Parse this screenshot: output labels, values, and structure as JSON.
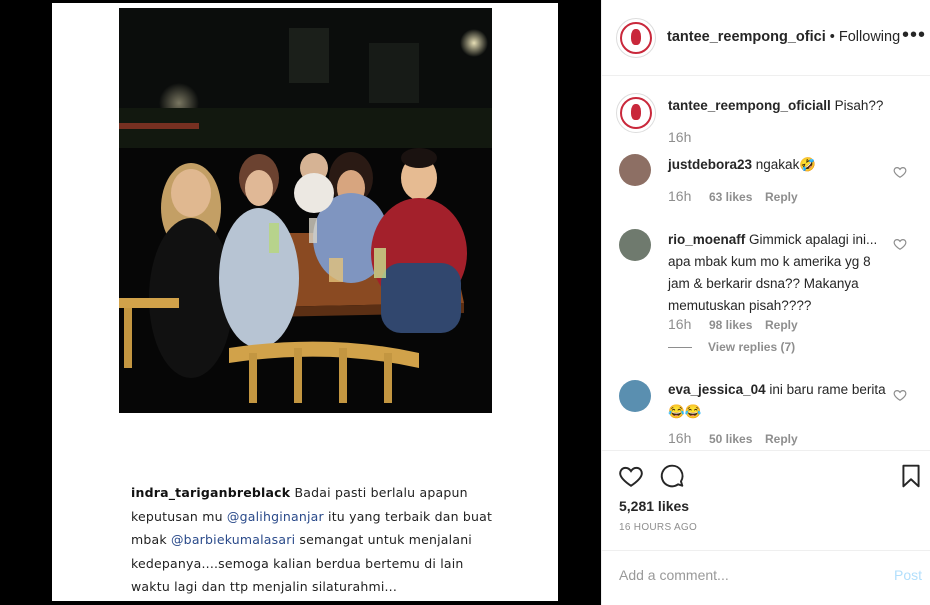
{
  "post": {
    "caption_user": "indra_tariganbreblack",
    "caption_lines": [
      " Badai pasti berlalu apapun",
      "keputusan mu ",
      " itu yang terbaik dan buat",
      "mbak ",
      " semangat untuk menjalani",
      "kedepanya....semoga kalian berdua bertemu di lain",
      "waktu lagi dan ttp menjalin silaturahmi..."
    ],
    "mention_1": "@galihginanjar",
    "mention_2": "@barbiekumalasari"
  },
  "header": {
    "username": "tantee_reempong_ofici",
    "separator": " • ",
    "follow_status": "Following",
    "more": "•••"
  },
  "comments": [
    {
      "user": "tantee_reempong_oficiall",
      "text": " Pisah??",
      "time": "16h",
      "likes": "",
      "reply": ""
    },
    {
      "user": "justdebora23",
      "text": " ngakak🤣",
      "time": "16h",
      "likes": "63 likes",
      "reply": "Reply"
    },
    {
      "user": "rio_moenaff",
      "text": " Gimmick apalagi ini... apa mbak kum mo k amerika yg 8 jam & berkarir dsna?? Makanya memutuskan pisah????",
      "time": "16h",
      "likes": "98 likes",
      "reply": "Reply",
      "view_replies": "View replies (7)"
    },
    {
      "user": "eva_jessica_04",
      "text": " ini baru rame berita 😂😂",
      "time": "16h",
      "likes": "50 likes",
      "reply": "Reply"
    }
  ],
  "actions": {
    "likes": "5,281 likes",
    "time_ago": "16 HOURS AGO"
  },
  "add_comment": {
    "placeholder": "Add a comment...",
    "post_label": "Post"
  },
  "colors": {
    "brand_red": "#c9283b",
    "post_disabled": "#b2dffc",
    "muted": "#8e8e8e"
  }
}
